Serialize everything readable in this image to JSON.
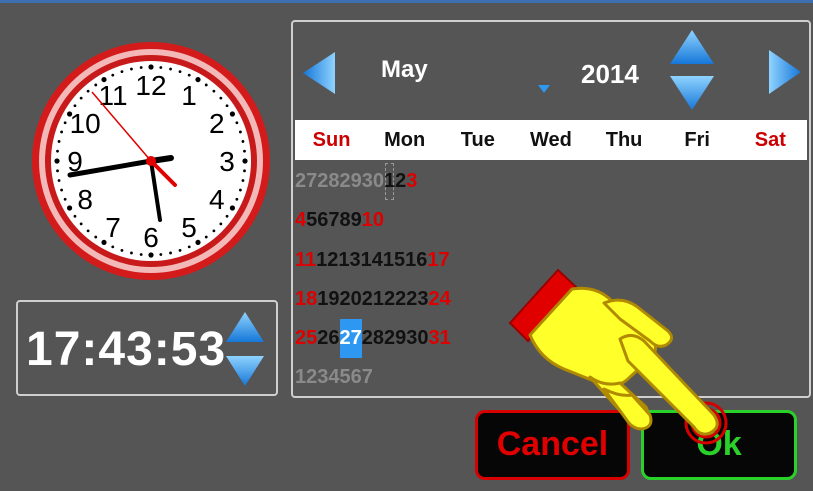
{
  "colors": {
    "accent_blue": "#2e97f1",
    "weekend_red": "#dd0000",
    "ok_green": "#2bd12b",
    "cancel_red": "#d60000"
  },
  "clock": {
    "numbers": [
      "12",
      "1",
      "2",
      "3",
      "4",
      "5",
      "6",
      "7",
      "8",
      "9",
      "10",
      "11"
    ]
  },
  "time": {
    "value": "17:43:53"
  },
  "calendar": {
    "month": "May",
    "year": "2014",
    "weekdays": [
      "Sun",
      "Mon",
      "Tue",
      "Wed",
      "Thu",
      "Fri",
      "Sat"
    ],
    "weeks": [
      [
        "27",
        "28",
        "29",
        "30",
        "1",
        "2",
        "3"
      ],
      [
        "4",
        "5",
        "6",
        "7",
        "8",
        "9",
        "10"
      ],
      [
        "11",
        "12",
        "13",
        "14",
        "15",
        "16",
        "17"
      ],
      [
        "18",
        "19",
        "20",
        "21",
        "22",
        "23",
        "24"
      ],
      [
        "25",
        "26",
        "27",
        "28",
        "29",
        "30",
        "31"
      ],
      [
        "1",
        "2",
        "3",
        "4",
        "5",
        "6",
        "7"
      ]
    ],
    "selected_day": "27"
  },
  "buttons": {
    "cancel": "Cancel",
    "ok": "Ok"
  },
  "icons": [
    "prev-month-arrow-icon",
    "next-month-arrow-icon",
    "year-up-icon",
    "year-down-icon",
    "time-up-icon",
    "time-down-icon",
    "hand-pointer-icon"
  ]
}
